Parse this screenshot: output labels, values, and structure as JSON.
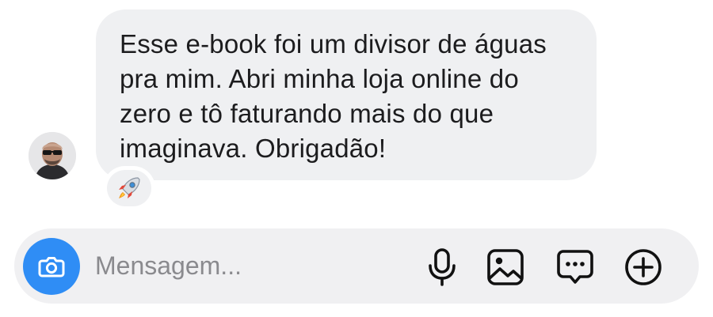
{
  "message": {
    "text": "Esse e-book foi um divisor de águas pra mim. Abri minha loja online do zero e tô faturando mais do que imaginava. Obrigadão!",
    "reaction": "🚀"
  },
  "composer": {
    "placeholder": "Mensagem...",
    "icons": [
      "camera-icon",
      "microphone-icon",
      "gallery-icon",
      "sticker-icon",
      "add-icon"
    ]
  },
  "colors": {
    "bubble": "#eff0f2",
    "composer": "#f0f0f2",
    "accent": "#2f8df5",
    "text": "#1c1c1e",
    "placeholder": "#8a8a8e"
  }
}
